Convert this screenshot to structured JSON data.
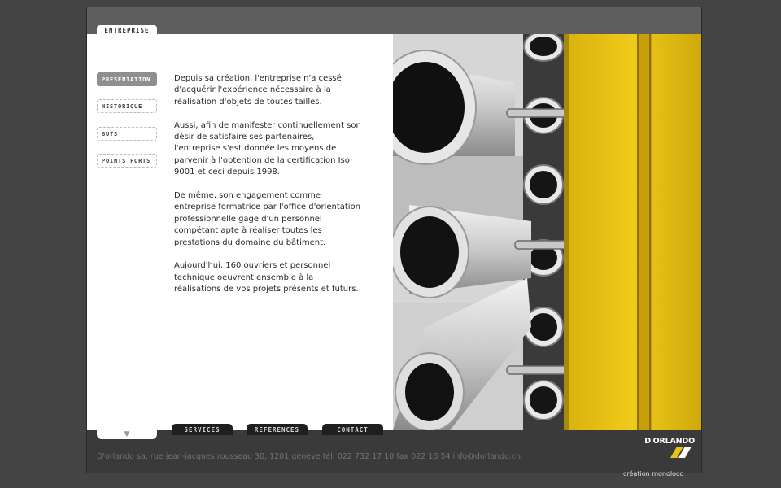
{
  "header": {
    "section_tab": "ENTREPRISE"
  },
  "submenu": {
    "items": [
      {
        "label": "PRESENTATION",
        "active": true
      },
      {
        "label": "HISTORIQUE",
        "active": false
      },
      {
        "label": "BUTS",
        "active": false
      },
      {
        "label": "POINTS FORTS",
        "active": false
      }
    ]
  },
  "content": {
    "paragraphs": [
      "Depuis sa création, l'entreprise n'a cessé d'acquérir l'expérience nécessaire à la réalisation d'objets de toutes tailles.",
      "Aussi, afin de manifester continuellement son désir de satisfaire ses partenaires, l'entreprise s'est donnée les moyens de parvenir à l'obtention de la certification Iso 9001 et ceci depuis 1998.",
      "De même, son engagement comme entreprise formatrice par l'office d'orientation professionnelle gage d'un personnel compétant apte à réaliser toutes les prestations du domaine du bâtiment.",
      "Aujourd'hui, 160 ouvriers et personnel technique oeuvrent ensemble à la réalisations de vos projets présents et futurs."
    ]
  },
  "nav": {
    "tabs": [
      "SERVICES",
      "REFERENCES",
      "CONTACT"
    ]
  },
  "footer": {
    "address": "D'orlando sa, rue jean-jacques rousseau 30, 1201 genève tél. 022 732 17 10 fax 022 16 54    info@dorlando.ch",
    "logo_text": "D'ORLANDO",
    "credit": "création monoloco"
  },
  "colors": {
    "accent_yellow": "#e8c316",
    "frame_gray": "#5e5e5e",
    "bottom_bar": "#3a3a3a"
  }
}
